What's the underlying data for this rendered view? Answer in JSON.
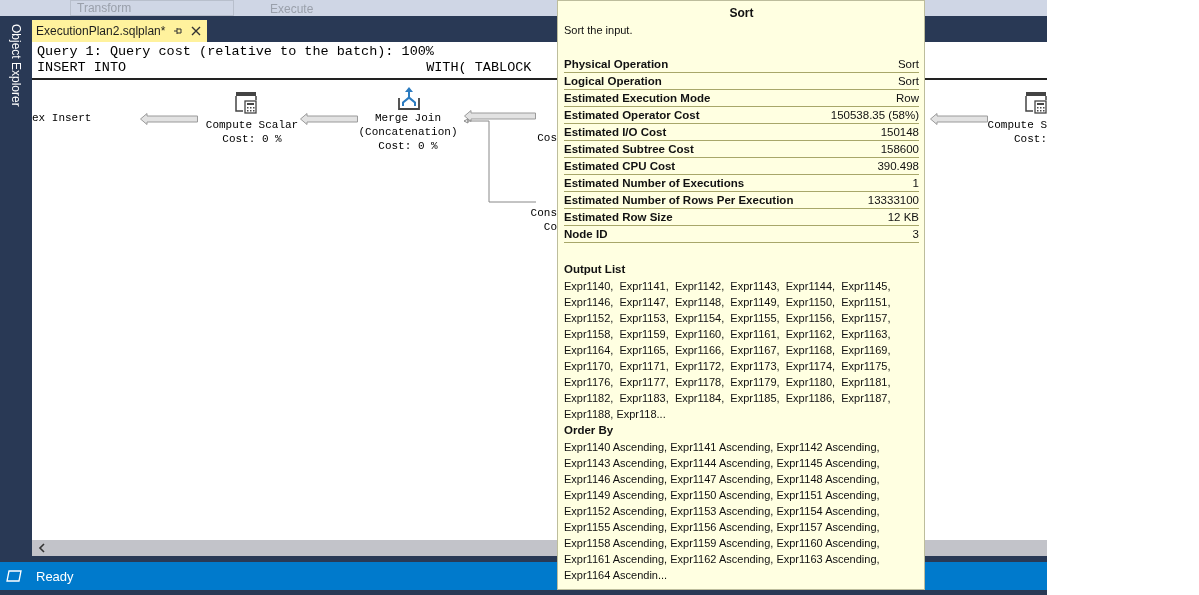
{
  "toolbar": {
    "configuration": "Transform",
    "execute_button": "Execute"
  },
  "tab": {
    "title": "ExecutionPlan2.sqlplan*",
    "selected": true
  },
  "sidebar": {
    "label": "Object Explorer"
  },
  "query_header": {
    "line_1": "Query 1: Query cost (relative to the batch): 100%",
    "statement_start": "INSERT INTO",
    "statement_hint": "WITH( TABLOCK"
  },
  "plan_nodes": [
    {
      "kind": "plain",
      "lines": [
        "ex Insert"
      ]
    },
    {
      "kind": "compute",
      "lines": [
        "Compute Scalar",
        "Cost: 0 %"
      ]
    },
    {
      "kind": "merge",
      "lines": [
        "Merge Join",
        "(Concatenation)",
        "Cost: 0 %"
      ]
    },
    {
      "kind": "plain",
      "lines": [
        "Cos"
      ]
    },
    {
      "kind": "plain",
      "lines": [
        "Cons",
        "Co"
      ]
    },
    {
      "kind": "compute",
      "lines": [
        "Compute S",
        "Cost:"
      ]
    }
  ],
  "tooltip": {
    "title": "Sort",
    "description": "Sort the input.",
    "properties": [
      {
        "label": "Physical Operation",
        "value": "Sort"
      },
      {
        "label": "Logical Operation",
        "value": "Sort"
      },
      {
        "label": "Estimated Execution Mode",
        "value": "Row"
      },
      {
        "label": "Estimated Operator Cost",
        "value": "150538.35 (58%)"
      },
      {
        "label": "Estimated I/O Cost",
        "value": "150148"
      },
      {
        "label": "Estimated Subtree Cost",
        "value": "158600"
      },
      {
        "label": "Estimated CPU Cost",
        "value": "390.498"
      },
      {
        "label": "Estimated Number of Executions",
        "value": "1"
      },
      {
        "label": "Estimated Number of Rows Per Execution",
        "value": "13333100"
      },
      {
        "label": "Estimated Row Size",
        "value": "12 KB"
      },
      {
        "label": "Node ID",
        "value": "3"
      }
    ],
    "sections": [
      {
        "heading": "Output List",
        "lines": [
          "Expr1140,  Expr1141,  Expr1142,  Expr1143,  Expr1144,  Expr1145,",
          "Expr1146,  Expr1147,  Expr1148,  Expr1149,  Expr1150,  Expr1151,",
          "Expr1152,  Expr1153,  Expr1154,  Expr1155,  Expr1156,  Expr1157,",
          "Expr1158,  Expr1159,  Expr1160,  Expr1161,  Expr1162,  Expr1163,",
          "Expr1164,  Expr1165,  Expr1166,  Expr1167,  Expr1168,  Expr1169,",
          "Expr1170,  Expr1171,  Expr1172,  Expr1173,  Expr1174,  Expr1175,",
          "Expr1176,  Expr1177,  Expr1178,  Expr1179,  Expr1180,  Expr1181,",
          "Expr1182,  Expr1183,  Expr1184,  Expr1185,  Expr1186,  Expr1187,",
          "Expr1188, Expr118..."
        ]
      },
      {
        "heading": "Order By",
        "lines": [
          "Expr1140 Ascending, Expr1141 Ascending, Expr1142 Ascending,",
          "Expr1143 Ascending, Expr1144 Ascending, Expr1145 Ascending,",
          "Expr1146 Ascending, Expr1147 Ascending, Expr1148 Ascending,",
          "Expr1149 Ascending, Expr1150 Ascending, Expr1151 Ascending,",
          "Expr1152 Ascending, Expr1153 Ascending, Expr1154 Ascending,",
          "Expr1155 Ascending, Expr1156 Ascending, Expr1157 Ascending,",
          "Expr1158 Ascending, Expr1159 Ascending, Expr1160 Ascending,",
          "Expr1161 Ascending, Expr1162 Ascending, Expr1163 Ascending,",
          "Expr1164 Ascendin..."
        ]
      }
    ]
  },
  "status_bar": {
    "text": "Ready"
  }
}
